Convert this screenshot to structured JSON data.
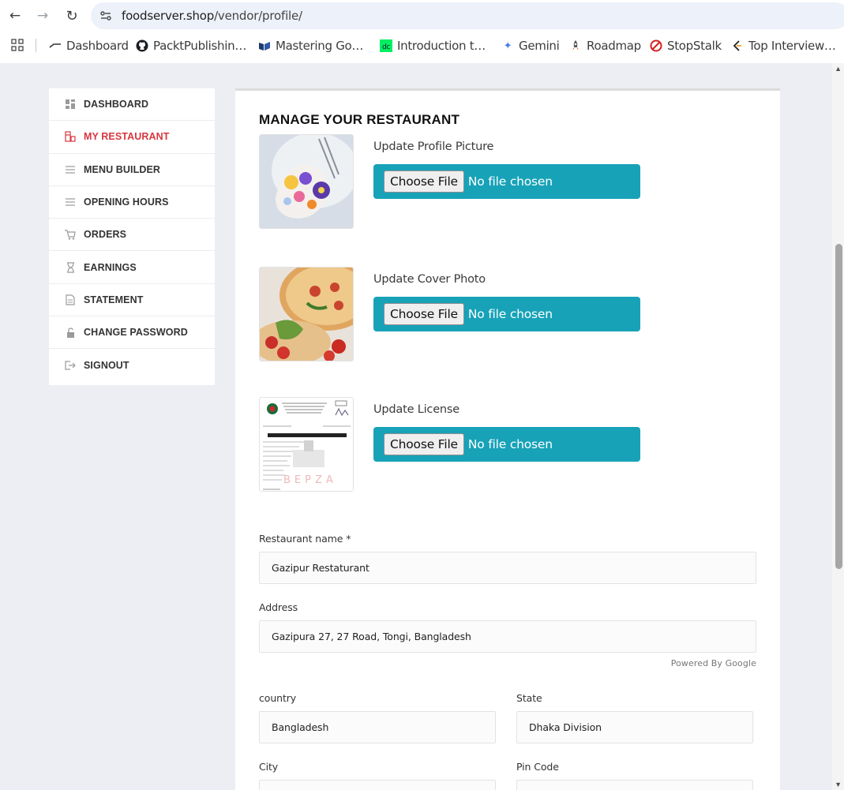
{
  "browser": {
    "url_host": "foodserver.shop",
    "url_path": "/vendor/profile/",
    "bookmarks": [
      {
        "label": "Dashboard",
        "icon": "dashboard-bookmark-icon"
      },
      {
        "label": "PacktPublishin…",
        "icon": "github-icon"
      },
      {
        "label": "Mastering Go…",
        "icon": "book-icon"
      },
      {
        "label": "Introduction t…",
        "icon": "dc-icon"
      },
      {
        "label": "Gemini",
        "icon": "gemini-sparkle-icon"
      },
      {
        "label": "Roadmap",
        "icon": "rocket-icon"
      },
      {
        "label": "StopStalk",
        "icon": "stopstalk-icon"
      },
      {
        "label": "Top Interview…",
        "icon": "leetcode-icon"
      }
    ]
  },
  "sidebar": {
    "items": [
      {
        "label": "DASHBOARD",
        "icon": "dashboard-icon",
        "active": false
      },
      {
        "label": "MY RESTAURANT",
        "icon": "restaurant-icon",
        "active": true
      },
      {
        "label": "MENU BUILDER",
        "icon": "menu-lines-icon",
        "active": false
      },
      {
        "label": "OPENING HOURS",
        "icon": "menu-lines-icon",
        "active": false
      },
      {
        "label": "ORDERS",
        "icon": "cart-icon",
        "active": false
      },
      {
        "label": "EARNINGS",
        "icon": "hourglass-icon",
        "active": false
      },
      {
        "label": "STATEMENT",
        "icon": "document-icon",
        "active": false
      },
      {
        "label": "CHANGE PASSWORD",
        "icon": "unlock-icon",
        "active": false
      },
      {
        "label": "SIGNOUT",
        "icon": "signout-icon",
        "active": false
      }
    ],
    "active_color": "#d9363e"
  },
  "main": {
    "title": "MANAGE YOUR RESTAURANT",
    "uploads": [
      {
        "label": "Update Profile Picture",
        "button": "Choose File",
        "status": "No file chosen"
      },
      {
        "label": "Update Cover Photo",
        "button": "Choose File",
        "status": "No file chosen"
      },
      {
        "label": "Update License",
        "button": "Choose File",
        "status": "No file chosen"
      }
    ],
    "upload_color": "#17a2b8",
    "form": {
      "restaurant_name_label": "Restaurant name *",
      "restaurant_name_value": "Gazipur Restaturant",
      "address_label": "Address",
      "address_value": "Gazipura 27, 27 Road, Tongi, Bangladesh",
      "powered_by": "Powered By Google",
      "country_label": "country",
      "country_value": "Bangladesh",
      "state_label": "State",
      "state_value": "Dhaka Division",
      "city_label": "City",
      "city_value": "",
      "pin_label": "Pin Code",
      "pin_value": ""
    }
  }
}
